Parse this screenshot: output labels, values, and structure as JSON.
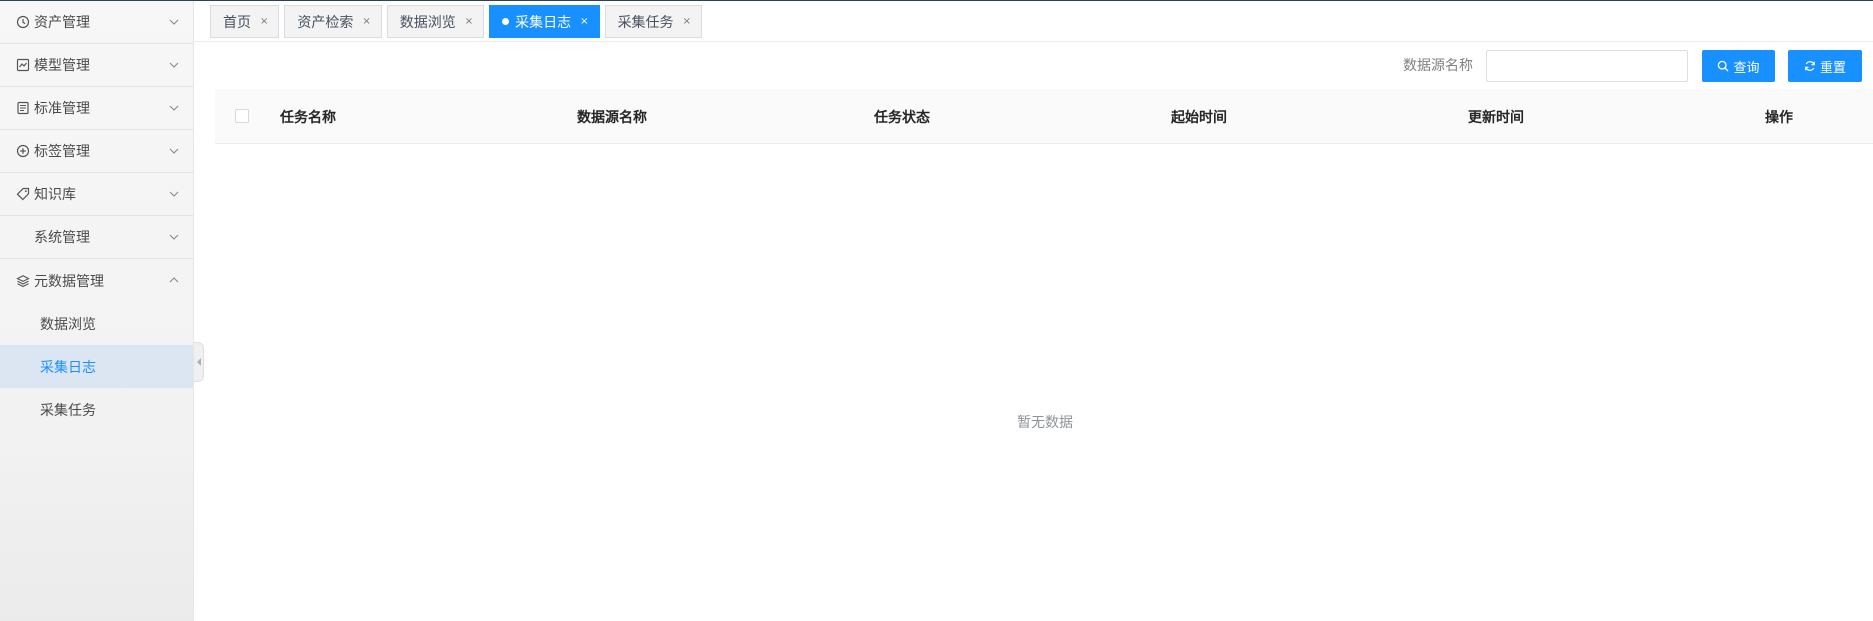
{
  "sidebar": {
    "items": [
      {
        "label": "资产管理",
        "icon": "clock-icon"
      },
      {
        "label": "模型管理",
        "icon": "chart-icon"
      },
      {
        "label": "标准管理",
        "icon": "document-icon"
      },
      {
        "label": "标签管理",
        "icon": "plus-circle-icon"
      },
      {
        "label": "知识库",
        "icon": "tag-icon"
      },
      {
        "label": "系统管理",
        "icon": ""
      },
      {
        "label": "元数据管理",
        "icon": "layers-icon"
      }
    ],
    "sub_items": [
      {
        "label": "数据浏览",
        "active": false
      },
      {
        "label": "采集日志",
        "active": true
      },
      {
        "label": "采集任务",
        "active": false
      }
    ]
  },
  "tabs": [
    {
      "label": "首页",
      "active": false
    },
    {
      "label": "资产检索",
      "active": false
    },
    {
      "label": "数据浏览",
      "active": false
    },
    {
      "label": "采集日志",
      "active": true
    },
    {
      "label": "采集任务",
      "active": false
    }
  ],
  "tab_close": "×",
  "search": {
    "label": "数据源名称",
    "value": "",
    "placeholder": ""
  },
  "buttons": {
    "query": "查询",
    "reset": "重置"
  },
  "table": {
    "columns": [
      "任务名称",
      "数据源名称",
      "任务状态",
      "起始时间",
      "更新时间",
      "操作"
    ],
    "rows": [],
    "empty_text": "暂无数据"
  },
  "colors": {
    "primary": "#1890ff",
    "active_bg": "#dbe6f2"
  }
}
